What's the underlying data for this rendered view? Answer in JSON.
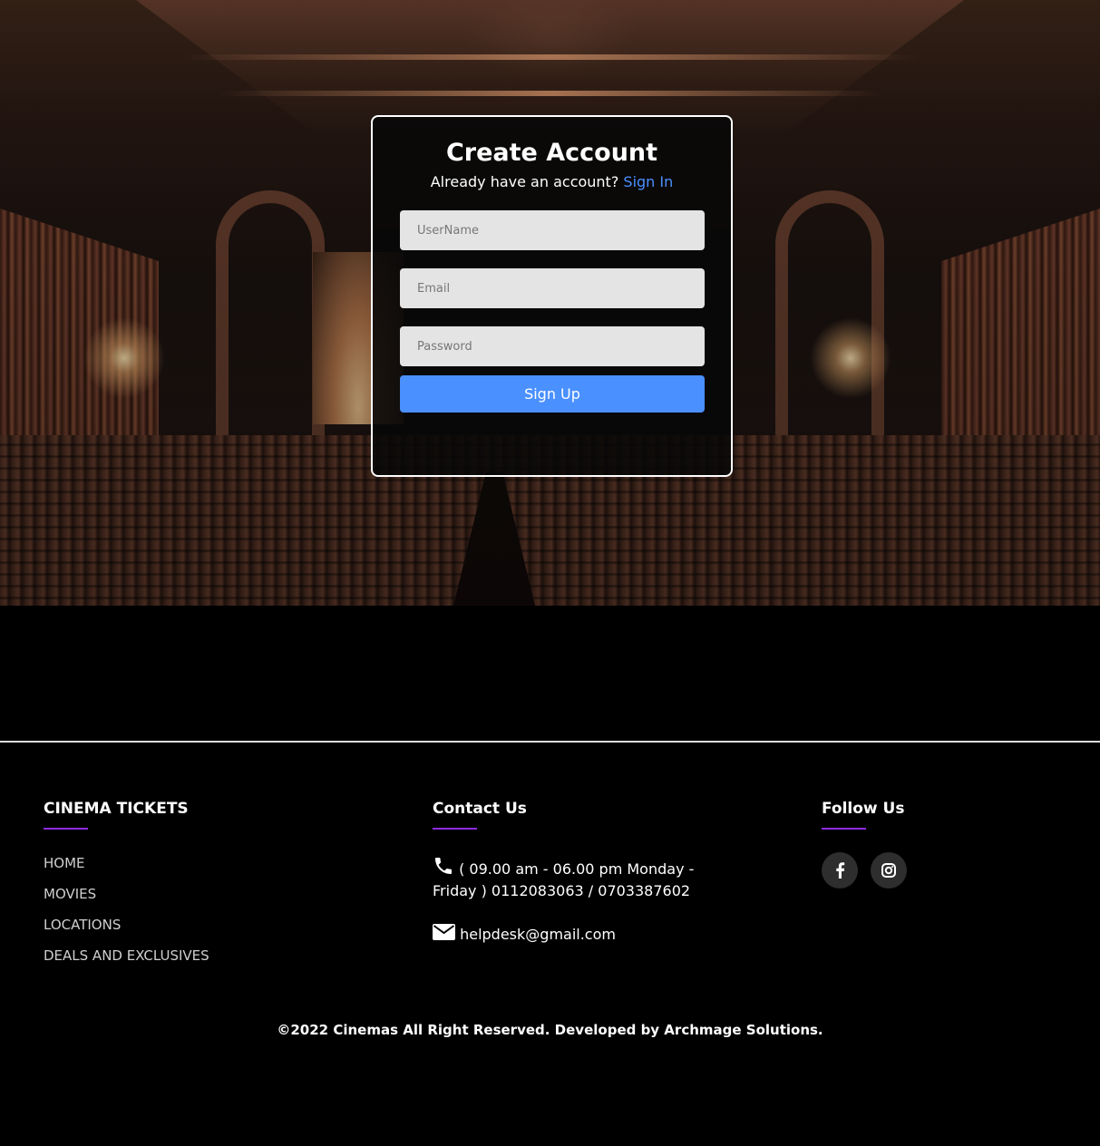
{
  "form": {
    "title": "Create Account",
    "subtitle": "Already have an account?",
    "signin_link": "Sign In",
    "username_placeholder": "UserName",
    "email_placeholder": "Email",
    "password_placeholder": "Password",
    "signup_label": "Sign Up"
  },
  "footer": {
    "brand_title": "CINEMA TICKETS",
    "nav": [
      "HOME",
      "MOVIES",
      "LOCATIONS",
      "DEALS AND EXCLUSIVES"
    ],
    "contact_title": "Contact Us",
    "hours_line1": "( 09.00 am - 06.00 pm Monday -",
    "hours_line2": "Friday ) 0112083063 / 0703387602",
    "email": "helpdesk@gmail.com",
    "follow_title": "Follow Us",
    "social": [
      "facebook-icon",
      "instagram-icon"
    ],
    "copyright": "©2022 Cinemas All Right Reserved. Developed by Archmage Solutions."
  },
  "colors": {
    "accent_blue": "#4a90ff",
    "underline_purple": "#8b2be2",
    "background": "#000000"
  }
}
